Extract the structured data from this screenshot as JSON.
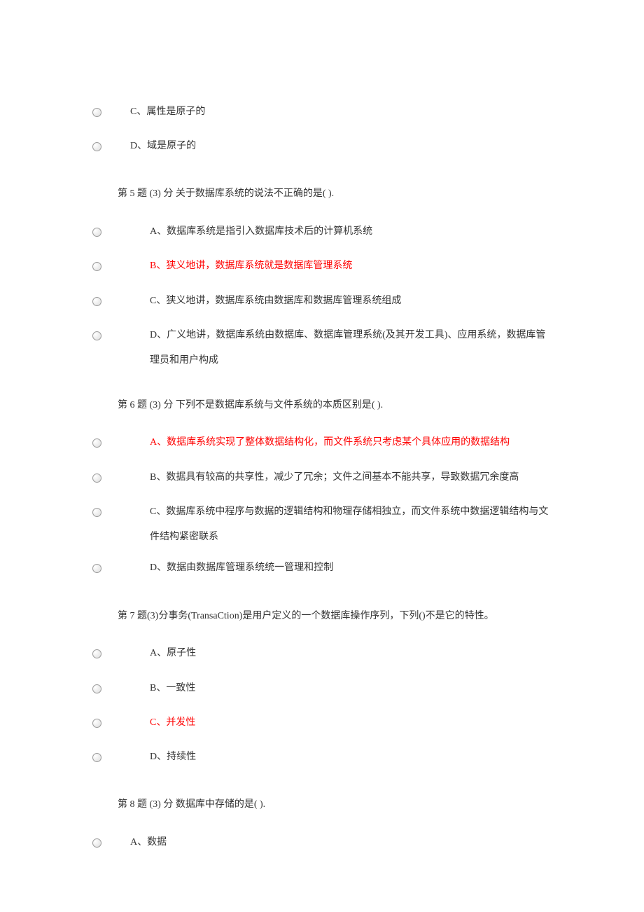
{
  "q4_options": {
    "c": "C、属性是原子的",
    "d": "D、域是原子的"
  },
  "q5": {
    "title": "第 5 题 (3) 分 关于数据库系统的说法不正确的是( ).",
    "a": "A、数据库系统是指引入数据库技术后的计算机系统",
    "b": "B、狭义地讲，数据库系统就是数据库管理系统",
    "c": "C、狭义地讲，数据库系统由数据库和数据库管理系统组成",
    "d": "D、广义地讲，数据库系统由数据库、数据库管理系统(及其开发工具)、应用系统，数据库管理员和用户构成"
  },
  "q6": {
    "title": "第 6 题 (3) 分 下列不是数据库系统与文件系统的本质区别是( ).",
    "a": "A、数据库系统实现了整体数据结构化，而文件系统只考虑某个具体应用的数据结构",
    "b": "B、数据具有较高的共享性，减少了冗余；文件之间基本不能共享，导致数据冗余度高",
    "c": "C、数据库系统中程序与数据的逻辑结构和物理存储相独立，而文件系统中数据逻辑结构与文件结构紧密联系",
    "d": "D、数据由数据库管理系统统一管理和控制"
  },
  "q7": {
    "title": "第 7 题(3)分事务(TransaCtion)是用户定义的一个数据库操作序列，下列()不是它的特性。",
    "a": "A、原子性",
    "b": "B、一致性",
    "c": "C、并发性",
    "d": "D、持续性"
  },
  "q8": {
    "title": "第 8 题 (3) 分 数据库中存储的是( ).",
    "a": "A、数据"
  }
}
